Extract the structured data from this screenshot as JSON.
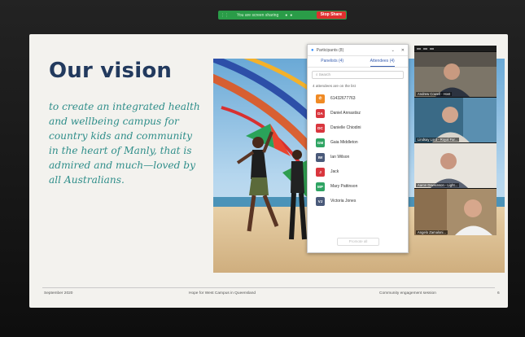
{
  "control_bar": {
    "status": "You are screen sharing",
    "stop_label": "Stop Share"
  },
  "slide": {
    "title": "Our vision",
    "vision_text": "to create an integrated health and wellbeing campus for country kids and community in the heart of Manly, that is admired and much—loved by all Australians.",
    "footer_left": "September 2020",
    "footer_center": "Hope for West Campus in Queensland",
    "footer_right": "Community engagement session",
    "page_number": "6"
  },
  "participants_panel": {
    "window_title": "Participants (8)",
    "tabs": [
      "Panelists (4)",
      "Attendees (4)"
    ],
    "search_placeholder": "Search",
    "info": "4 attendees are on the list",
    "attendees": [
      {
        "initials": "",
        "name": "61432677763",
        "color": "#f08a24",
        "icon": "phone-icon"
      },
      {
        "initials": "DA",
        "name": "Daniel Annastisz",
        "color": "#d9363e"
      },
      {
        "initials": "DC",
        "name": "Danielle Chiodini",
        "color": "#d9363e"
      },
      {
        "initials": "GM",
        "name": "Gaia Middleton",
        "color": "#2fa463"
      },
      {
        "initials": "IW",
        "name": "Ian Wilson",
        "color": "#4a5a7a"
      },
      {
        "initials": "J",
        "name": "Jack",
        "color": "#d9363e"
      },
      {
        "initials": "MP",
        "name": "Mary Pattinson",
        "color": "#2fa463"
      },
      {
        "initials": "VJ",
        "name": "Victoria Jones",
        "color": "#4a5a7a"
      }
    ],
    "button_label": "Promote all"
  },
  "video_panel": {
    "tiles": [
      {
        "caption": "Andrew Cowell - Host"
      },
      {
        "caption": "Lindsay Lord - Royal Far..."
      },
      {
        "caption": "Aaron Dawkinson - Light..."
      },
      {
        "caption": "Angelo Zamaloni..."
      }
    ]
  }
}
